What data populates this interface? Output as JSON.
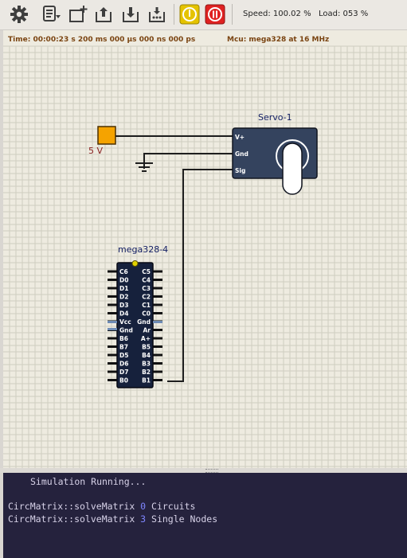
{
  "toolbar": {
    "buttons": [
      {
        "name": "settings",
        "icon": "gear-icon"
      },
      {
        "name": "circuit-menu",
        "icon": "circuit-menu-icon"
      },
      {
        "name": "new-circuit",
        "icon": "new-circuit-icon"
      },
      {
        "name": "open-circuit",
        "icon": "open-folder-icon"
      },
      {
        "name": "save-circuit",
        "icon": "save-folder-icon"
      },
      {
        "name": "save-as-circuit",
        "icon": "save-as-icon"
      },
      {
        "name": "power-circuit",
        "icon": "power-icon"
      },
      {
        "name": "pause-simulation",
        "icon": "pause-icon"
      }
    ],
    "speed_label": "Speed: 100.02 %",
    "load_label": "Load: 053 %",
    "power_color": "#e5c300",
    "pause_color": "#e02222"
  },
  "canvas": {
    "time_label": "Time: 00:00:23 s  200 ms  000 µs  000 ns  000 ps",
    "mcu_label": "Mcu: mega328 at 16 MHz",
    "grid_color": "#cfcec0",
    "background": "#eeebe0",
    "components": {
      "voltage_source": {
        "label": "5 V",
        "color": "#f5a300"
      },
      "ground": {
        "label": ""
      },
      "servo": {
        "label": "Servo-1",
        "pins": [
          "V+",
          "Gnd",
          "Sig"
        ],
        "body_color": "#34435e"
      },
      "mcu": {
        "label": "mega328-4",
        "left_pins": [
          "C6",
          "D0",
          "D1",
          "D2",
          "D3",
          "D4",
          "Vcc",
          "Gnd",
          "B6",
          "B7",
          "D5",
          "D6",
          "D7",
          "B0"
        ],
        "right_pins": [
          "C5",
          "C4",
          "C3",
          "C2",
          "C1",
          "C0",
          "Gnd",
          "Ar",
          "A+",
          "B5",
          "B4",
          "B3",
          "B2",
          "B1"
        ],
        "body_color": "#16213c"
      }
    }
  },
  "console": {
    "status": "Simulation Running...",
    "lines": [
      {
        "prefix": "CircMatrix::solveMatrix ",
        "number": "0",
        "suffix": " Circuits"
      },
      {
        "prefix": "CircMatrix::solveMatrix ",
        "number": "3",
        "suffix": " Single Nodes"
      }
    ]
  }
}
